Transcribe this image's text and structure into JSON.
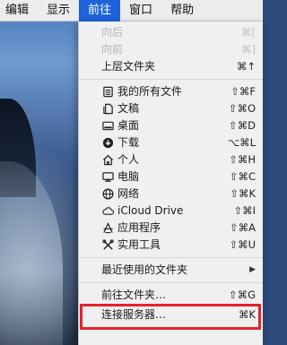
{
  "menubar": {
    "items": [
      {
        "label": "编辑"
      },
      {
        "label": "显示"
      },
      {
        "label": "前往"
      },
      {
        "label": "窗口"
      },
      {
        "label": "帮助"
      }
    ]
  },
  "menu": {
    "back": {
      "label": "向后",
      "shortcut": "⌘["
    },
    "forward": {
      "label": "向前",
      "shortcut": "⌘]"
    },
    "enclosing": {
      "label": "上层文件夹",
      "shortcut": "⌘↑"
    },
    "places": [
      {
        "label": "我的所有文件",
        "shortcut": "⇧⌘F",
        "icon": "all-files-icon"
      },
      {
        "label": "文稿",
        "shortcut": "⇧⌘O",
        "icon": "documents-icon"
      },
      {
        "label": "桌面",
        "shortcut": "⇧⌘D",
        "icon": "desktop-icon"
      },
      {
        "label": "下载",
        "shortcut": "⌥⌘L",
        "icon": "downloads-icon"
      },
      {
        "label": "个人",
        "shortcut": "⇧⌘H",
        "icon": "home-icon"
      },
      {
        "label": "电脑",
        "shortcut": "⇧⌘C",
        "icon": "computer-icon"
      },
      {
        "label": "网络",
        "shortcut": "⇧⌘K",
        "icon": "network-icon"
      },
      {
        "label": "iCloud Drive",
        "shortcut": "⇧⌘I",
        "icon": "icloud-icon"
      },
      {
        "label": "应用程序",
        "shortcut": "⇧⌘A",
        "icon": "applications-icon"
      },
      {
        "label": "实用工具",
        "shortcut": "⇧⌘U",
        "icon": "utilities-icon"
      }
    ],
    "recent": {
      "label": "最近使用的文件夹",
      "arrow": "▶"
    },
    "goto_folder": {
      "label": "前往文件夹…",
      "shortcut": "⇧⌘G"
    },
    "connect_server": {
      "label": "连接服务器…",
      "shortcut": "⌘K"
    }
  },
  "colors": {
    "accent": "#1d63d9",
    "highlight_border": "#e8202a"
  }
}
